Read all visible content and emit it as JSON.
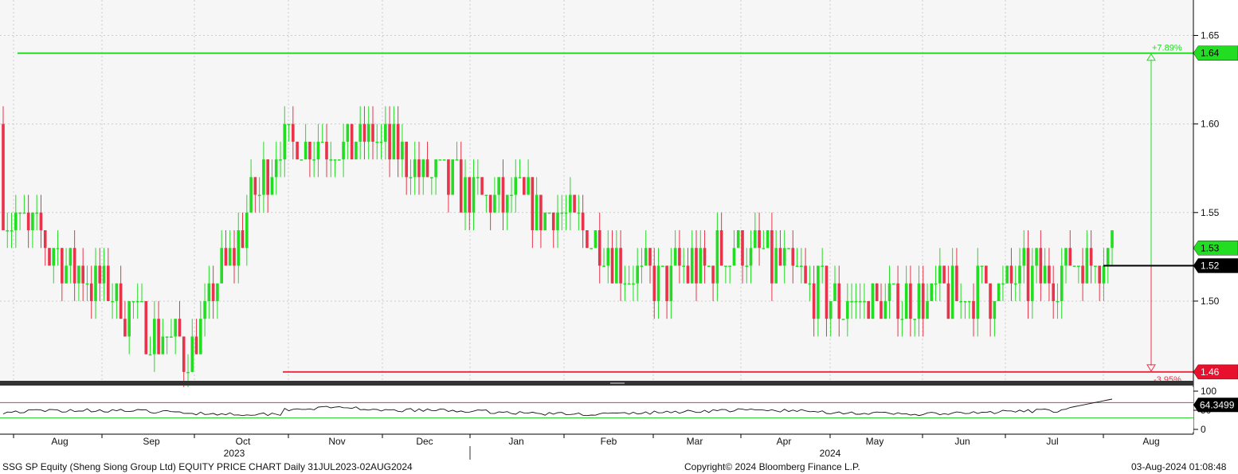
{
  "footer": {
    "left": "SSG SP Equity (Sheng Siong Group Ltd) EQUITY PRICE CHART  Daily 31JUL2023-02AUG2024",
    "center": "Copyright© 2024 Bloomberg Finance L.P.",
    "right": "03-Aug-2024 01:08:48"
  },
  "colors": {
    "up": "#22dd22",
    "down": "#e8334a",
    "high_line": "#22dd22",
    "low_line": "#e8334a",
    "current": "#000000"
  },
  "chart_data": {
    "type": "candlestick",
    "title": "",
    "y_ticks": [
      "1.65",
      "1.60",
      "1.55",
      "1.50"
    ],
    "ylim": [
      1.455,
      1.67
    ],
    "x_months": [
      "Aug",
      "Sep",
      "Oct",
      "Nov",
      "Dec",
      "Jan",
      "Feb",
      "Mar",
      "Apr",
      "May",
      "Jun",
      "Jul",
      "Aug"
    ],
    "year_labels": [
      "2023",
      "2024"
    ],
    "grid": true,
    "high_line": {
      "value": 1.64,
      "label": "1.64",
      "pct_label": "+7.89%"
    },
    "low_line": {
      "value": 1.46,
      "label": "1.46",
      "pct_label": "-3.95%"
    },
    "last_price": {
      "value": 1.53,
      "label": "1.53"
    },
    "current_line": {
      "value": 1.52,
      "label": "1.52"
    },
    "monthly_close": [
      {
        "month": "Aug 2023",
        "close": 1.55
      },
      {
        "month": "Sep 2023",
        "close": 1.51
      },
      {
        "month": "Oct 2023",
        "close": 1.47
      },
      {
        "month": "Nov 2023",
        "close": 1.59
      },
      {
        "month": "Dec 2023",
        "close": 1.59
      },
      {
        "month": "Jan 2024",
        "close": 1.56
      },
      {
        "month": "Feb 2024",
        "close": 1.55
      },
      {
        "month": "Mar 2024",
        "close": 1.51
      },
      {
        "month": "Apr 2024",
        "close": 1.53
      },
      {
        "month": "May 2024",
        "close": 1.5
      },
      {
        "month": "Jun 2024",
        "close": 1.5
      },
      {
        "month": "Jul 2024",
        "close": 1.51
      },
      {
        "month": "Aug 2024",
        "close": 1.53
      }
    ],
    "indicator": {
      "type": "RSI",
      "ticks": [
        "100",
        "50",
        "0"
      ],
      "last_value": "64.3499",
      "upper_band": 70,
      "lower_band": 30
    }
  }
}
